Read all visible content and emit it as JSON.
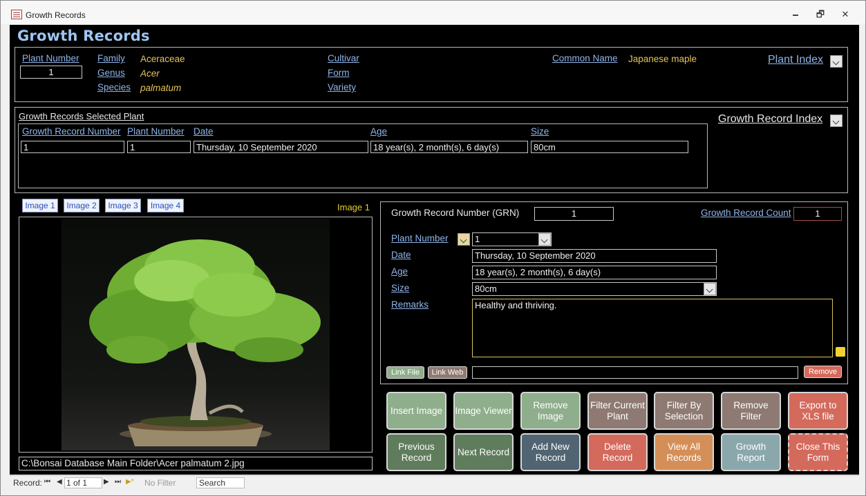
{
  "window": {
    "title": "Growth Records",
    "minimize": "🗕",
    "restore": "🗗",
    "close": "✕"
  },
  "header": {
    "title": "Growth Records"
  },
  "plant": {
    "plant_number_label": "Plant Number",
    "plant_number": "1",
    "family_label": "Family",
    "family": "Aceraceae",
    "genus_label": "Genus",
    "genus": "Acer",
    "species_label": "Species",
    "species": "palmatum",
    "cultivar_label": "Cultivar",
    "form_label": "Form",
    "variety_label": "Variety",
    "common_name_label": "Common Name",
    "common_name": "Japanese maple",
    "plant_index_label": "Plant Index"
  },
  "selected": {
    "title": "Growth Records Selected Plant",
    "columns": [
      "Growth Record Number",
      "Plant Number",
      "Date",
      "Age",
      "Size"
    ],
    "rows": [
      [
        "1",
        "1",
        "Thursday, 10 September 2020",
        "18 year(s), 2 month(s), 6 day(s)",
        "80cm"
      ]
    ],
    "index_label": "Growth Record Index"
  },
  "images": {
    "tabs": [
      "Image 1",
      "Image 2",
      "Image 3",
      "Image 4"
    ],
    "current": "Image 1",
    "path": "C:\\Bonsai Database Main Folder\\Acer palmatum 2.jpg"
  },
  "detail": {
    "grn_label": "Growth Record Number (GRN)",
    "grn": "1",
    "count_label": "Growth Record Count",
    "count": "1",
    "plant_number_label": "Plant Number",
    "plant_number": "1",
    "date_label": "Date",
    "date": "Thursday, 10 September 2020",
    "age_label": "Age",
    "age": "18 year(s), 2 month(s), 6 day(s)",
    "size_label": "Size",
    "size": "80cm",
    "remarks_label": "Remarks",
    "remarks": "Healthy and thriving.",
    "link_file": "Link File",
    "link_web": "Link Web",
    "remove": "Remove"
  },
  "buttons": {
    "insert_image": "Insert Image",
    "image_viewer": "Image Viewer",
    "remove_image": "Remove Image",
    "filter_current": "Filter Current Plant",
    "filter_selection": "Filter By Selection",
    "remove_filter": "Remove Filter",
    "export": "Export to XLS file",
    "previous": "Previous Record",
    "next": "Next Record",
    "add_new": "Add New Record",
    "delete": "Delete Record",
    "view_all": "View All Records",
    "growth_report": "Growth Report",
    "close_form": "Close This Form"
  },
  "status": {
    "record_label": "Record:",
    "position": "1 of 1",
    "filter": "No Filter",
    "search": "Search"
  },
  "colors": {
    "accent_blue": "#8fb5ea",
    "value_gold": "#e6c45a",
    "header_blue": "#9fc5f2",
    "green_btn": "#8fae8c",
    "red_btn": "#d46a5c",
    "brown_btn": "#8e7a72"
  }
}
